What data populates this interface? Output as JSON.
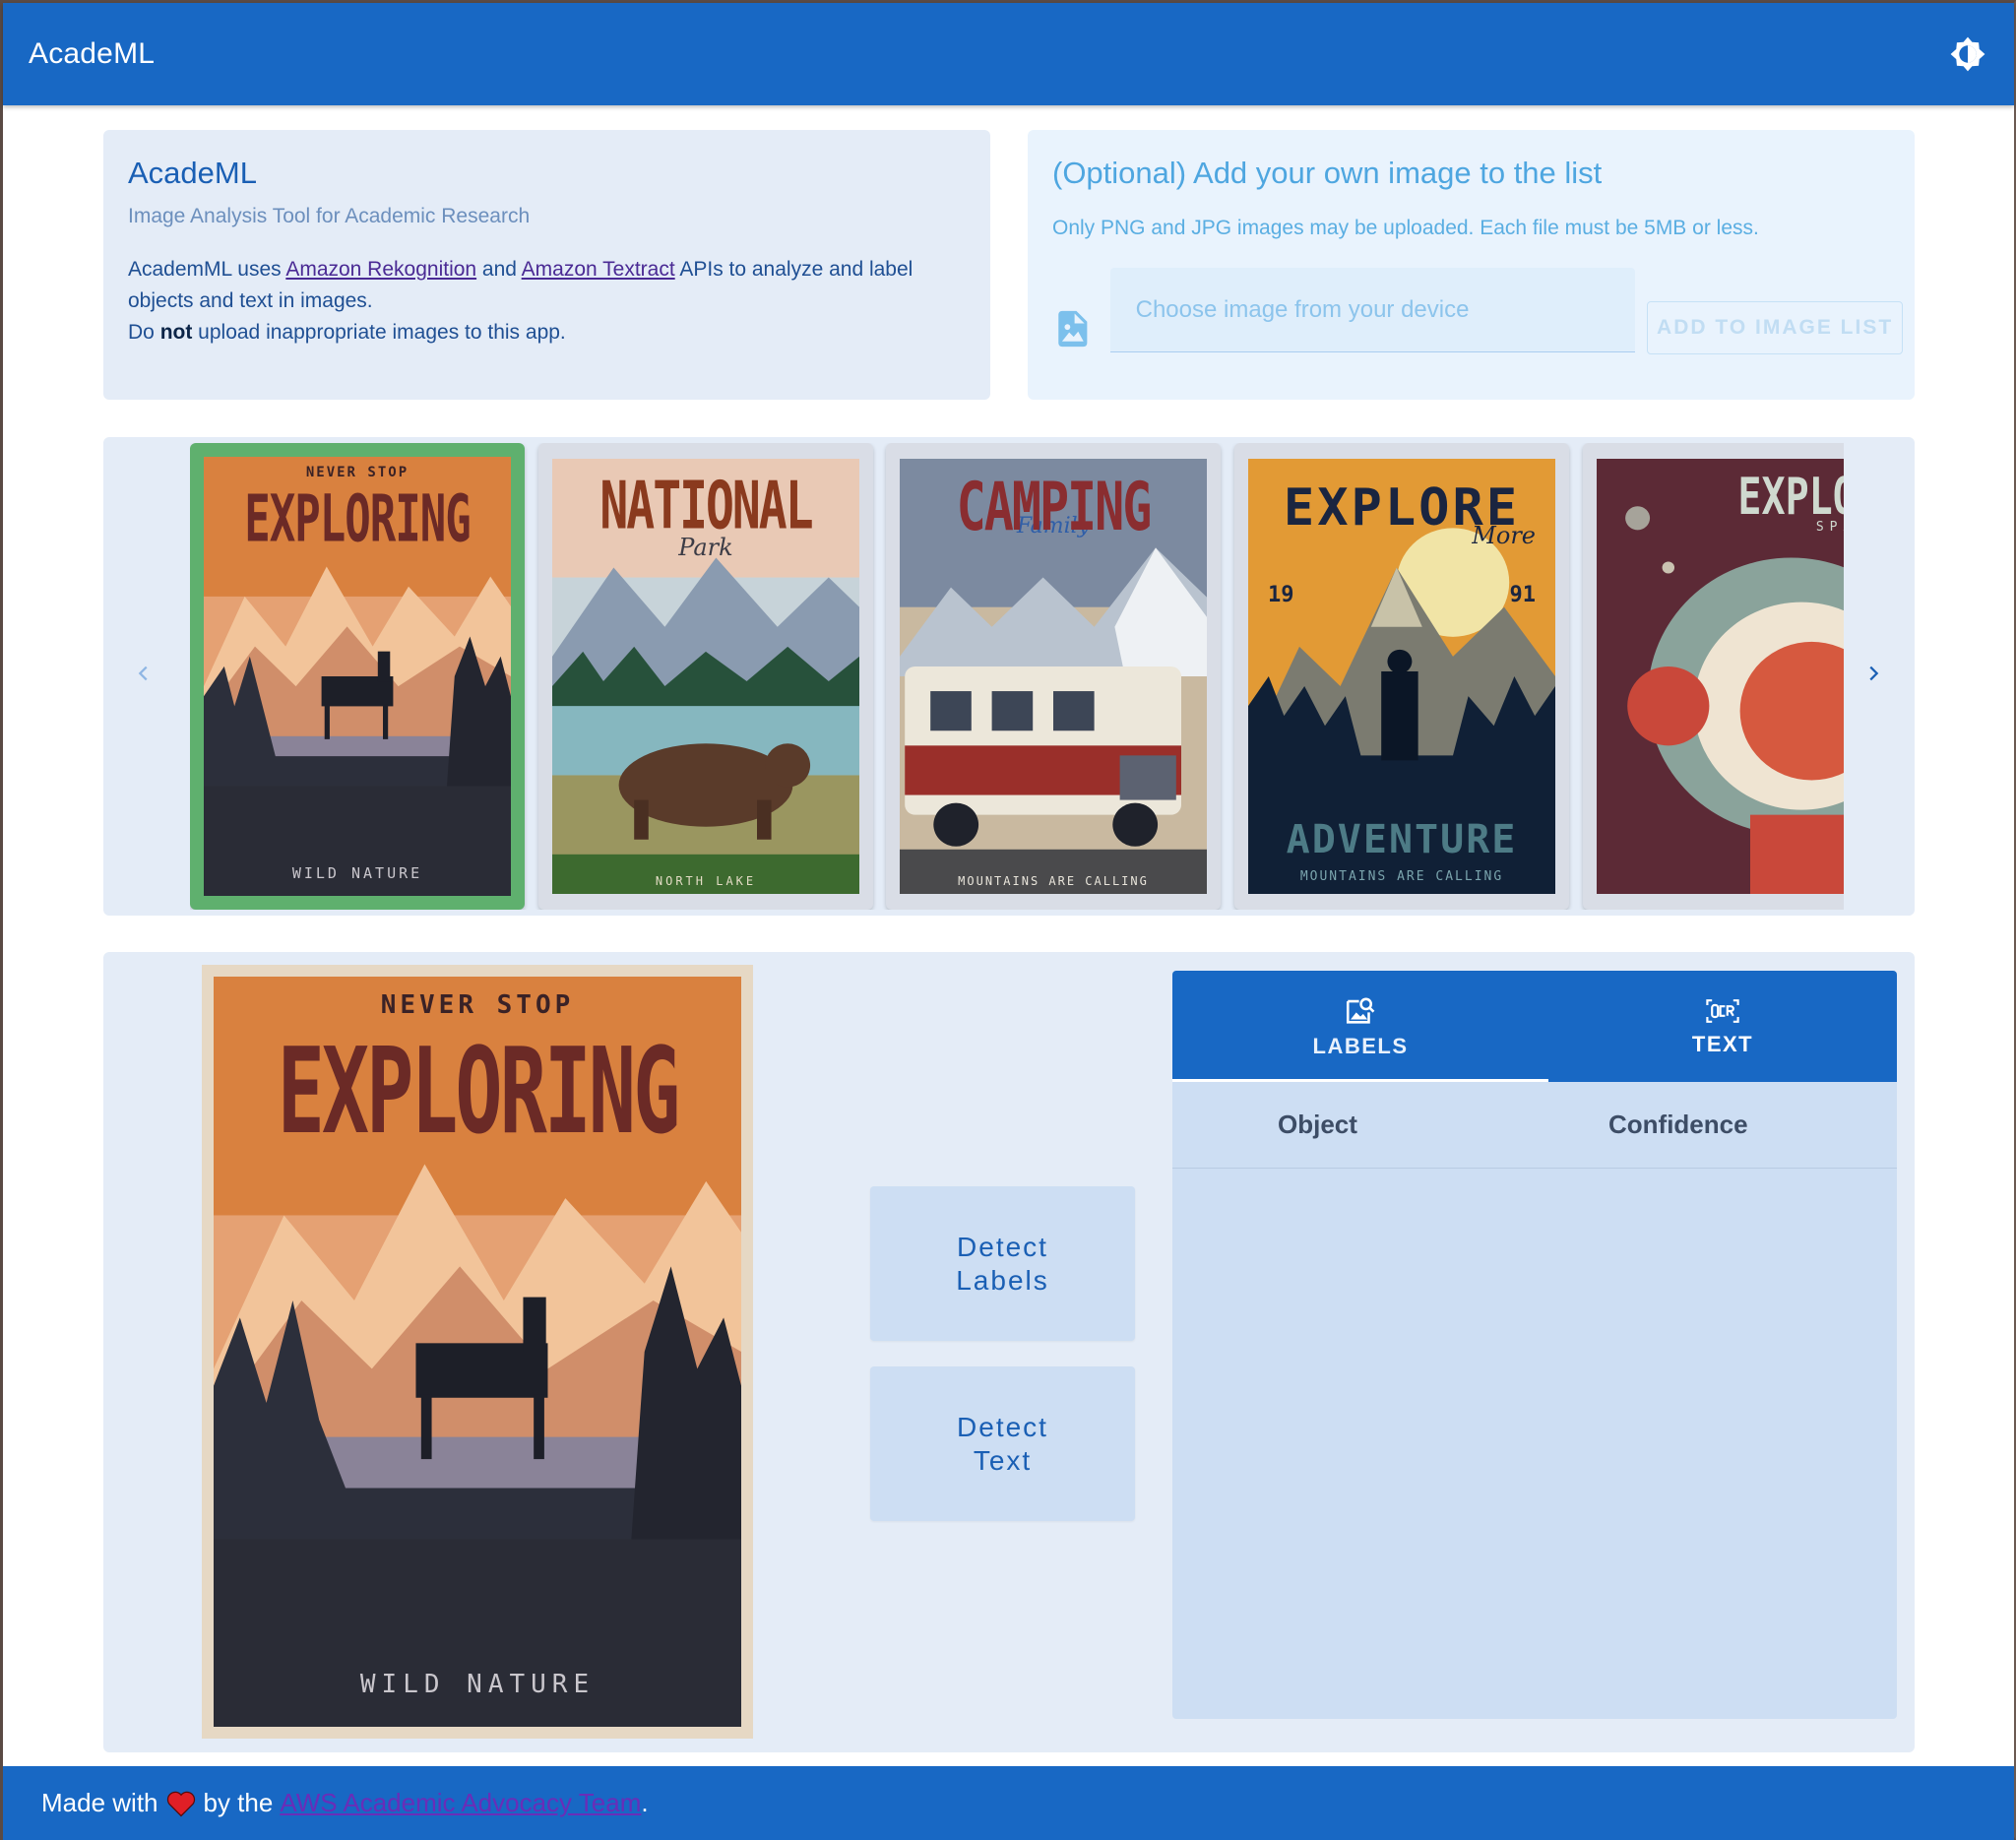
{
  "app": {
    "title": "AcadeML"
  },
  "intro": {
    "title": "AcadeML",
    "subtitle": "Image Analysis Tool for Academic Research",
    "line1_prefix": "AcademML uses ",
    "link_rekognition": "Amazon Rekognition",
    "line1_and": " and ",
    "link_textract": "Amazon Textract",
    "line1_suffix": " APIs to analyze and label objects and text in images.",
    "line2_prefix": "Do ",
    "line2_bold": "not",
    "line2_suffix": " upload inappropriate images to this app."
  },
  "upload": {
    "title": "(Optional) Add your own image to the list",
    "note": "Only PNG and JPG images may be uploaded. Each file must be 5MB or less.",
    "placeholder": "Choose image from your device",
    "button": "ADD TO IMAGE LIST"
  },
  "carousel": {
    "items": [
      {
        "top": "NEVER STOP",
        "main": "EXPLORING",
        "bottom": "WILD NATURE",
        "accent": "",
        "selected": true
      },
      {
        "top": "",
        "main": "NATIONAL",
        "bottom": "NORTH LAKE",
        "accent": "Park",
        "selected": false
      },
      {
        "top": "",
        "main": "CAMPING",
        "bottom": "MOUNTAINS ARE CALLING",
        "accent": "Family",
        "selected": false
      },
      {
        "top": "",
        "main": "EXPLORE",
        "bottom": "MOUNTAINS ARE CALLING",
        "accent": "More",
        "year_left": "19",
        "year_right": "91",
        "subhead": "ADVENTURE",
        "selected": false
      },
      {
        "top": "",
        "main": "EXPLORE",
        "bottom": "",
        "accent": "SPACE",
        "selected": false
      }
    ]
  },
  "preview": {
    "top": "NEVER STOP",
    "main": "EXPLORING",
    "bottom": "WILD NATURE"
  },
  "actions": {
    "detect_labels": "Detect Labels",
    "detect_text": "Detect Text"
  },
  "results": {
    "tabs": [
      {
        "label": "LABELS"
      },
      {
        "label": "TEXT"
      }
    ],
    "columns": [
      "Object",
      "Confidence"
    ]
  },
  "footer": {
    "prefix": "Made with",
    "by": "by the",
    "link": "AWS Academic Advocacy Team",
    "suffix": "."
  },
  "colors": {
    "primary": "#1868c4",
    "card_bg": "#e4ecf7",
    "selected_border": "#5fb06e"
  }
}
